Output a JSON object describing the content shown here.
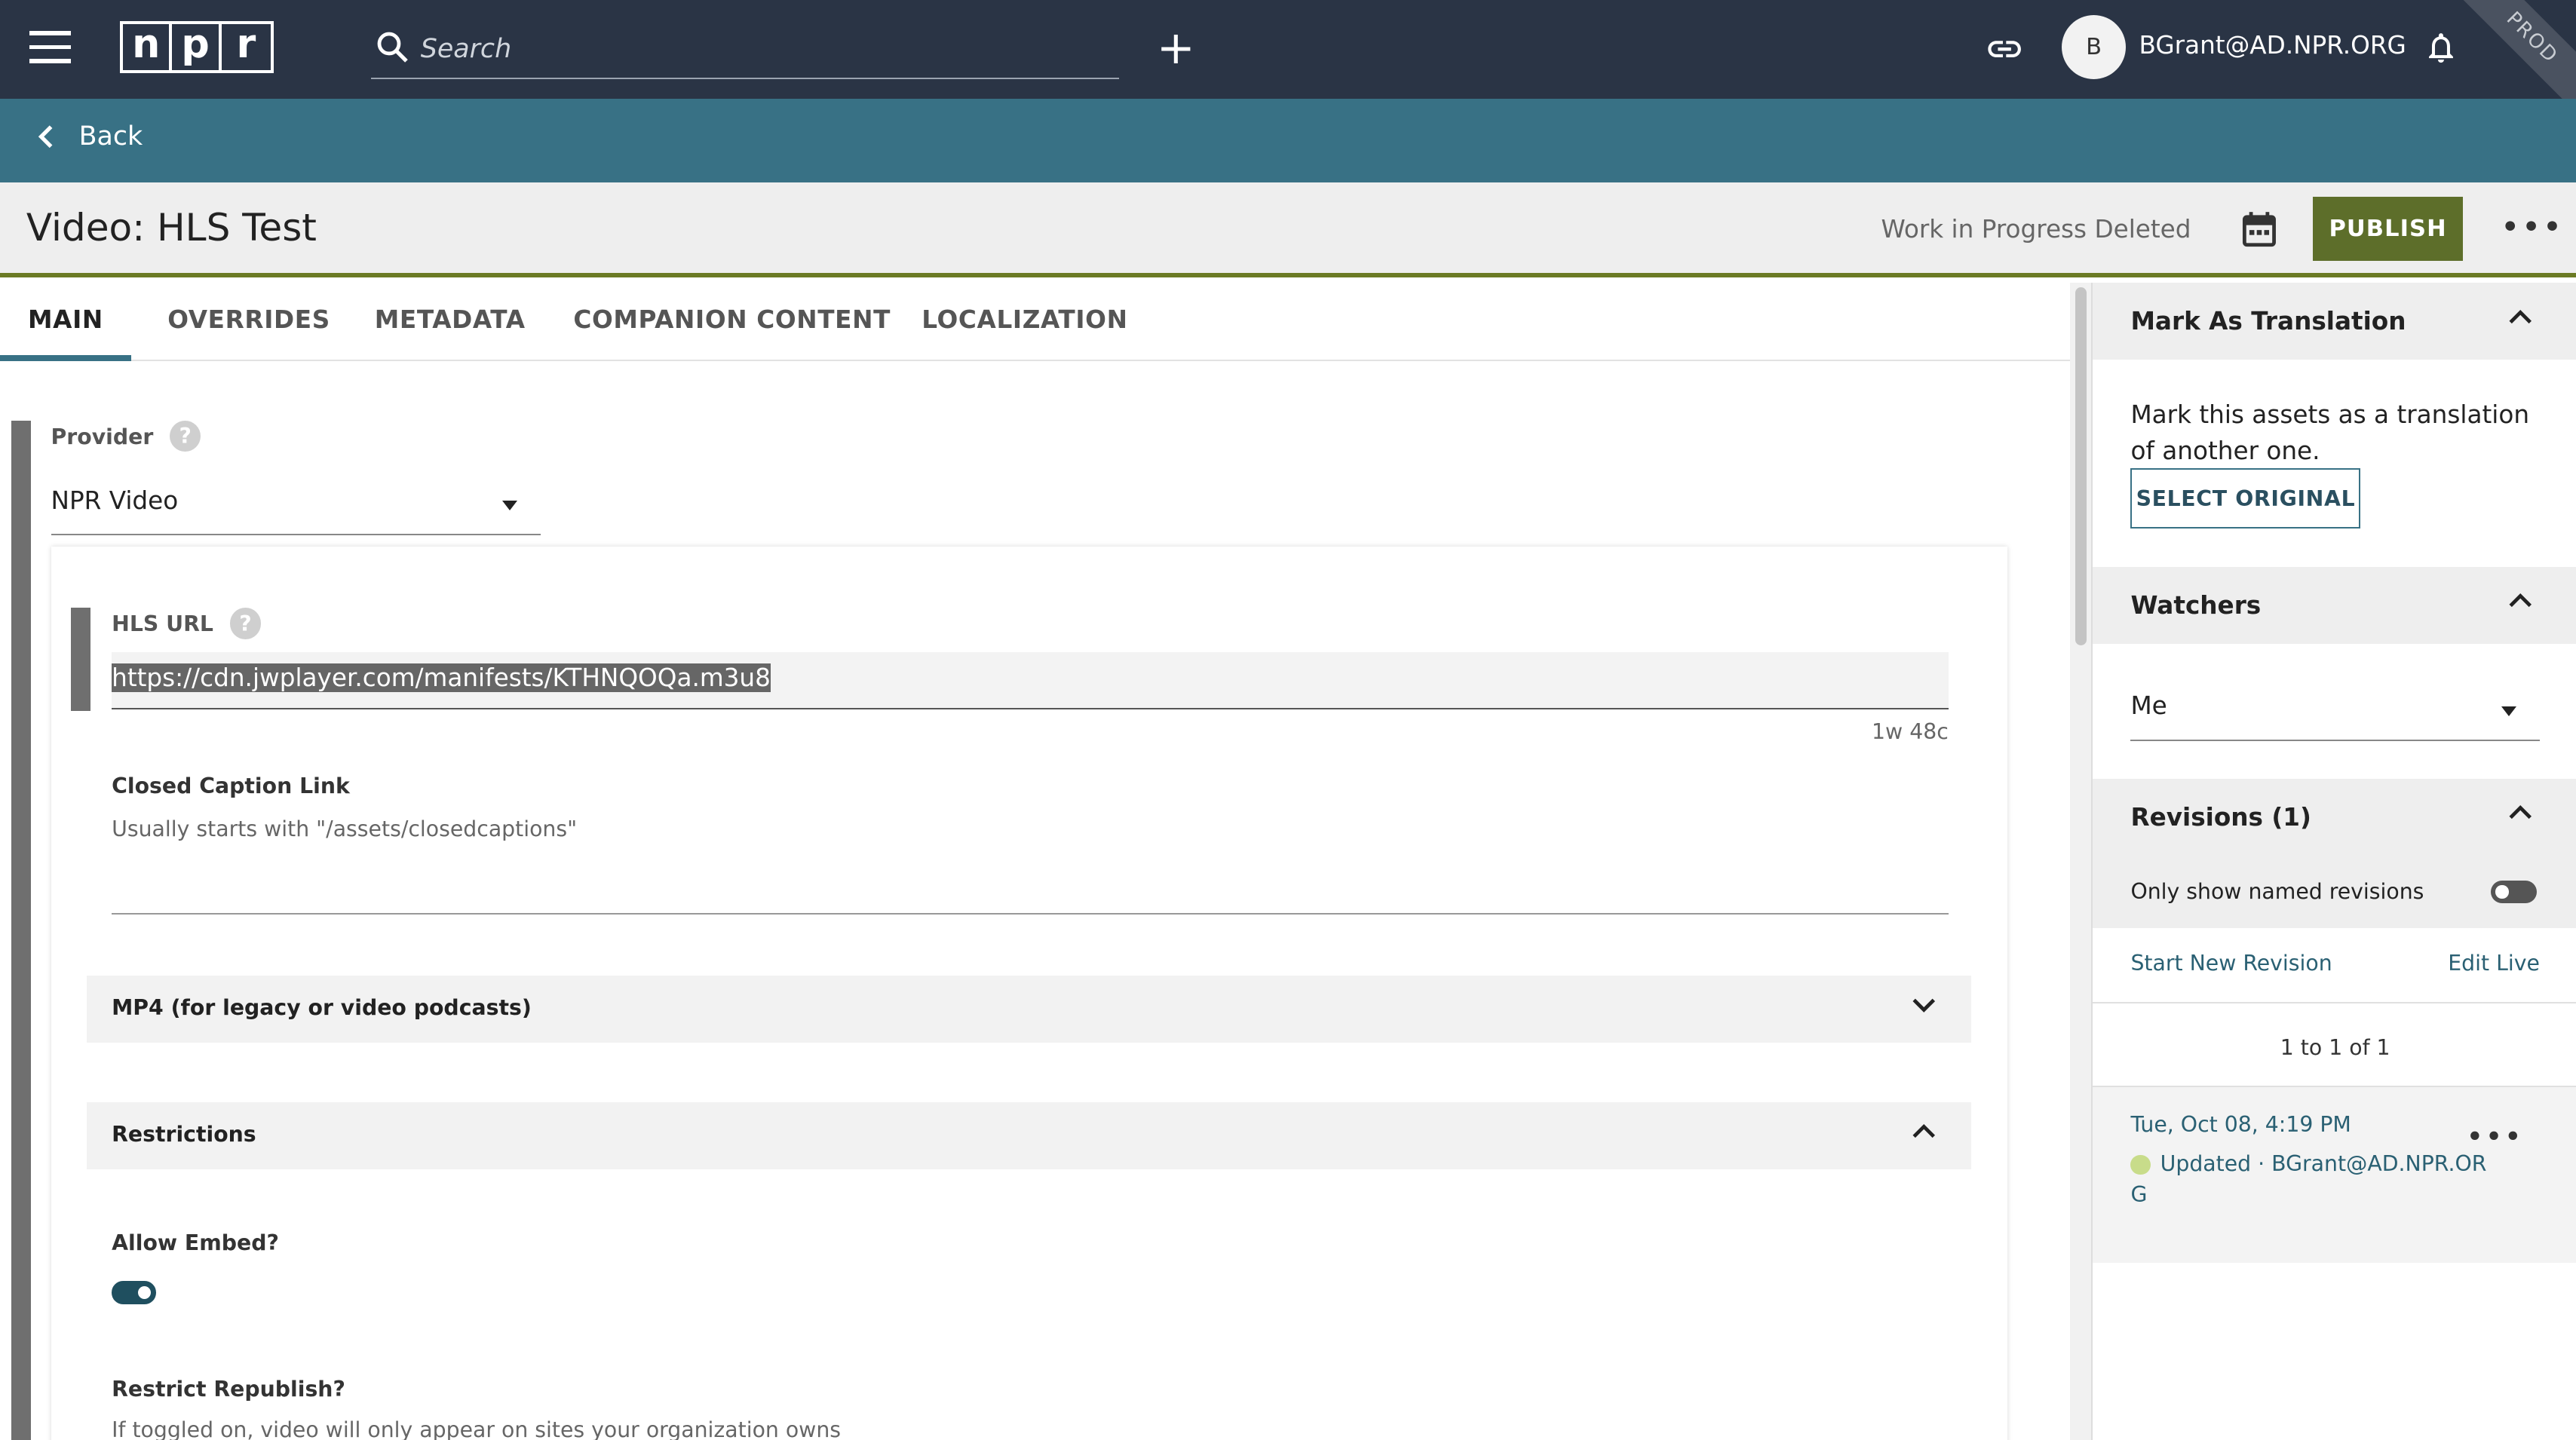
{
  "topbar": {
    "logo_letters": [
      "n",
      "p",
      "r"
    ],
    "search_placeholder": "Search",
    "user_initial": "B",
    "username": "BGrant@AD.NPR.ORG",
    "env_badge": "PROD"
  },
  "backbar": {
    "back_label": "Back"
  },
  "titlebar": {
    "title": "Video: HLS Test",
    "status": "Work in Progress Deleted",
    "publish_label": "PUBLISH"
  },
  "tabs": [
    {
      "label": "MAIN",
      "active": true
    },
    {
      "label": "OVERRIDES"
    },
    {
      "label": "METADATA"
    },
    {
      "label": "COMPANION CONTENT"
    },
    {
      "label": "LOCALIZATION"
    }
  ],
  "main": {
    "provider_label": "Provider",
    "provider_value": "NPR Video",
    "hls_label": "HLS URL",
    "hls_value": "https://cdn.jwplayer.com/manifests/KTHNQOQa.m3u8",
    "hls_counter": "1w 48c",
    "cc_label": "Closed Caption Link",
    "cc_hint": "Usually starts with \"/assets/closedcaptions\"",
    "mp4_section": "MP4 (for legacy or video podcasts)",
    "restrictions_section": "Restrictions",
    "allow_embed_label": "Allow Embed?",
    "allow_embed_on": true,
    "restrict_label": "Restrict Republish?",
    "restrict_hint": "If toggled on, video will only appear on sites your organization owns"
  },
  "sidebar": {
    "translation": {
      "title": "Mark As Translation",
      "text": "Mark this assets as a translation of another one.",
      "button": "SELECT ORIGINAL"
    },
    "watchers": {
      "title": "Watchers",
      "value": "Me"
    },
    "revisions": {
      "title": "Revisions (1)",
      "named_toggle_label": "Only show named revisions",
      "named_toggle_on": false,
      "start_new": "Start New Revision",
      "edit_live": "Edit Live",
      "page_count": "1 to 1 of 1",
      "entry": {
        "date": "Tue, Oct 08, 4:19 PM",
        "status": "Updated",
        "separator": "·",
        "user": "BGrant@AD.NPR.ORG"
      }
    }
  },
  "colors": {
    "topbar": "#2a3445",
    "backbar": "#387185",
    "publish": "#5d6e2a",
    "accent_line": "#6b7a24"
  }
}
